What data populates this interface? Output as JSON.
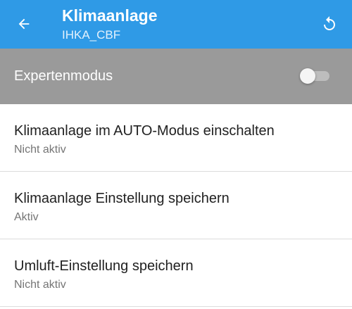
{
  "app_bar": {
    "title": "Klimaanlage",
    "subtitle": "IHKA_CBF",
    "color": "#2f9ae6",
    "back_icon": "arrow-left-icon",
    "reset_icon": "reset-icon"
  },
  "expert_mode": {
    "label": "Expertenmodus",
    "enabled": false,
    "background": "#9a9a9a"
  },
  "settings": [
    {
      "title": "Klimaanlage im AUTO-Modus einschalten",
      "status": "Nicht aktiv"
    },
    {
      "title": "Klimaanlage Einstellung speichern",
      "status": "Aktiv"
    },
    {
      "title": "Umluft-Einstellung speichern",
      "status": "Nicht aktiv"
    }
  ]
}
